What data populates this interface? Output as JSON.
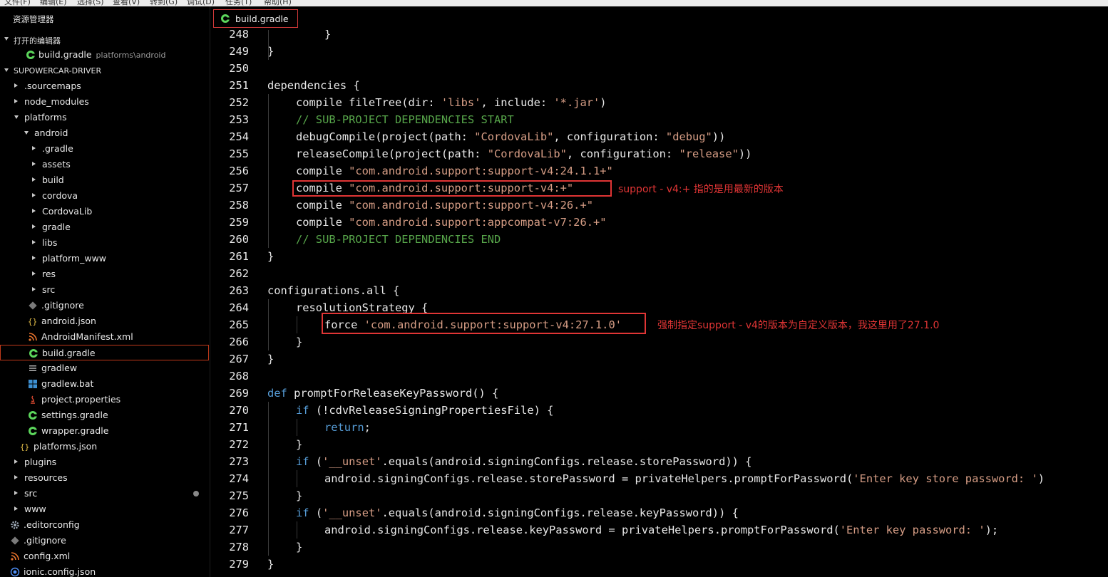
{
  "menubar": [
    "文件(F)",
    "编辑(E)",
    "选择(S)",
    "查看(V)",
    "转到(G)",
    "调试(D)",
    "任务(T)",
    "帮助(H)"
  ],
  "sidebar": {
    "title": "资源管理器",
    "open_editors": {
      "label": "打开的编辑器",
      "file": "build.gradle",
      "path": "platforms\\android"
    },
    "project": "SUPOWERCAR-DRIVER",
    "tree": [
      {
        "label": ".sourcemaps"
      },
      {
        "label": "node_modules"
      },
      {
        "label": "platforms"
      },
      {
        "label": "android"
      },
      {
        "label": ".gradle"
      },
      {
        "label": "assets"
      },
      {
        "label": "build"
      },
      {
        "label": "cordova"
      },
      {
        "label": "CordovaLib"
      },
      {
        "label": "gradle"
      },
      {
        "label": "libs"
      },
      {
        "label": "platform_www"
      },
      {
        "label": "res"
      },
      {
        "label": "src"
      },
      {
        "label": ".gitignore"
      },
      {
        "label": "android.json"
      },
      {
        "label": "AndroidManifest.xml"
      },
      {
        "label": "build.gradle"
      },
      {
        "label": "gradlew"
      },
      {
        "label": "gradlew.bat"
      },
      {
        "label": "project.properties"
      },
      {
        "label": "settings.gradle"
      },
      {
        "label": "wrapper.gradle"
      },
      {
        "label": "platforms.json"
      },
      {
        "label": "plugins"
      },
      {
        "label": "resources"
      },
      {
        "label": "src"
      },
      {
        "label": "www"
      },
      {
        "label": ".editorconfig"
      },
      {
        "label": ".gitignore"
      },
      {
        "label": "config.xml"
      },
      {
        "label": "ionic.config.json"
      }
    ]
  },
  "tab": {
    "label": "build.gradle"
  },
  "editor": {
    "line_numbers": [
      "248",
      "249",
      "250",
      "251",
      "252",
      "253",
      "254",
      "255",
      "256",
      "257",
      "258",
      "259",
      "260",
      "261",
      "262",
      "263",
      "264",
      "265",
      "266",
      "267",
      "268",
      "269",
      "270",
      "271",
      "272",
      "273",
      "274",
      "275",
      "276",
      "277",
      "278",
      "279"
    ]
  },
  "annotations": {
    "note1": "support - v4:+  指的是用最新的版本",
    "note2": "强制指定support - v4的版本为自定义版本，我这里用了27.1.0"
  },
  "colors": {
    "annotation_red": "#e03535",
    "string": "#d69d85",
    "comment": "#57a64a",
    "keyword": "#569cd6",
    "gradle_icon": "#5cd65c"
  }
}
